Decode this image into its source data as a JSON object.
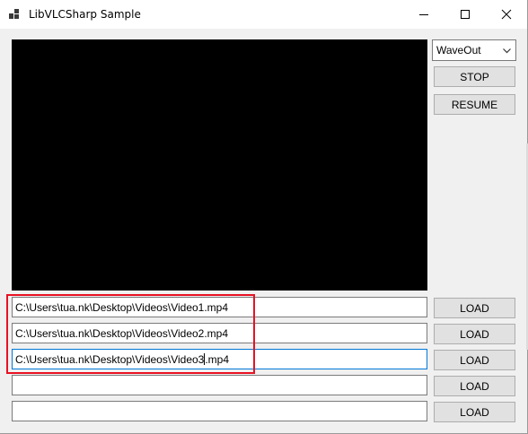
{
  "window": {
    "title": "LibVLCSharp Sample"
  },
  "titlebar_icons": [
    "app-icon",
    "minimize-icon",
    "maximize-icon",
    "close-icon"
  ],
  "audio_output": {
    "selected": "WaveOut"
  },
  "controls": {
    "stop_label": "STOP",
    "resume_label": "RESUME"
  },
  "media_rows": [
    {
      "path": "C:\\Users\\tua.nk\\Desktop\\Videos\\Video1.mp4",
      "load_label": "LOAD"
    },
    {
      "path": "C:\\Users\\tua.nk\\Desktop\\Videos\\Video2.mp4",
      "load_label": "LOAD"
    },
    {
      "path_before_caret": "C:\\Users\\tua.nk\\Desktop\\Videos\\Video3",
      "path_after_caret": ".mp4",
      "load_label": "LOAD"
    },
    {
      "path": "",
      "load_label": "LOAD"
    },
    {
      "path": "",
      "load_label": "LOAD"
    }
  ],
  "colors": {
    "highlight": "#e81123",
    "focus": "#0078d7",
    "video_background": "#000000"
  }
}
